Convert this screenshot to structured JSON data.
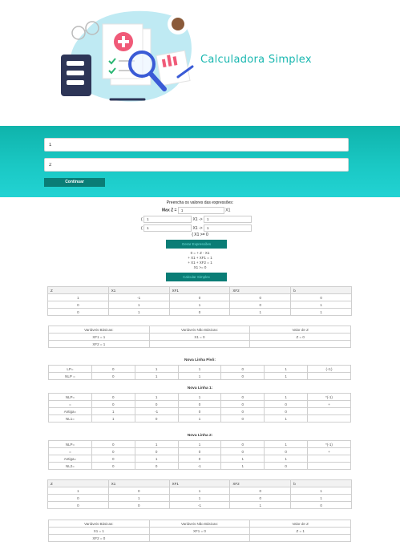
{
  "header": {
    "title": "Calculadora Simplex"
  },
  "form": {
    "input1_value": "1",
    "input2_value": "2",
    "continue_label": "Continuar"
  },
  "expr_section": {
    "title": "Preencha os valores das expressões:",
    "maxz_label": "Max Z =",
    "maxz_value": "1",
    "maxz_var": "X1",
    "r1_prefix": "(",
    "r1_a": "1",
    "r1_mid": "X1 ->",
    "r1_b": "1",
    "r2_prefix": "(",
    "r2_a": "1",
    "r2_mid": "X1 ->",
    "r2_b": "1",
    "nonneg": "{ X1 >= 0",
    "btn_label": "Gerar Expressões",
    "lines": [
      "0 = + Z - X1",
      "+ X1 + XF1 = 1",
      "+ X1 + XF2 = 1",
      "X1 >= 0"
    ],
    "btn2_label": "Calcular Simplex"
  },
  "table1": {
    "headers": [
      "Z",
      "X1",
      "XF1",
      "XF2",
      "b"
    ],
    "rows": [
      [
        "1",
        "-1",
        "0",
        "0",
        "0"
      ],
      [
        "0",
        "1",
        "1",
        "0",
        "1"
      ],
      [
        "0",
        "1",
        "0",
        "1",
        "1"
      ]
    ]
  },
  "vars1": {
    "headers": [
      "Variáveis Básicas:",
      "Variáveis Não Básicas:",
      "Valor de Z"
    ],
    "rows": [
      [
        "XF1 = 1",
        "X1 = 0",
        "Z = 0"
      ],
      [
        "XF2 = 1",
        "",
        ""
      ]
    ]
  },
  "pivot": {
    "title": "Nova Linha Pivô:",
    "rows": [
      [
        "LP=",
        "0",
        "1",
        "1",
        "0",
        "1",
        "(÷1)"
      ],
      [
        "NLP =",
        "0",
        "1",
        "1",
        "0",
        "1",
        ""
      ]
    ]
  },
  "line1": {
    "title": "Nova Linha 1:",
    "rows": [
      [
        "NLP=",
        "0",
        "1",
        "1",
        "0",
        "1",
        "*(-1)"
      ],
      [
        "=",
        "0",
        "0",
        "0",
        "0",
        "0",
        "+"
      ],
      [
        "Antiga=",
        "1",
        "-1",
        "0",
        "0",
        "0",
        ""
      ],
      [
        "NL1=",
        "1",
        "0",
        "1",
        "0",
        "1",
        ""
      ]
    ]
  },
  "line2": {
    "title": "Nova Linha 2:",
    "rows": [
      [
        "NLP=",
        "0",
        "1",
        "1",
        "0",
        "1",
        "*(-1)"
      ],
      [
        "=",
        "0",
        "0",
        "0",
        "0",
        "0",
        "+"
      ],
      [
        "Antiga=",
        "0",
        "1",
        "0",
        "1",
        "1",
        ""
      ],
      [
        "NL2=",
        "0",
        "0",
        "-1",
        "1",
        "0",
        ""
      ]
    ]
  },
  "table2": {
    "headers": [
      "Z",
      "X1",
      "XF1",
      "XF2",
      "b"
    ],
    "rows": [
      [
        "1",
        "0",
        "1",
        "0",
        "1"
      ],
      [
        "0",
        "1",
        "1",
        "0",
        "1"
      ],
      [
        "0",
        "0",
        "-1",
        "1",
        "0"
      ]
    ]
  },
  "vars2": {
    "headers": [
      "Variáveis Básicas:",
      "Variáveis Não Básicas:",
      "Valor de Z"
    ],
    "rows": [
      [
        "X1 = 1",
        "XF1 = 0",
        "Z = 1"
      ],
      [
        "XF2 = 0",
        "",
        ""
      ]
    ]
  }
}
